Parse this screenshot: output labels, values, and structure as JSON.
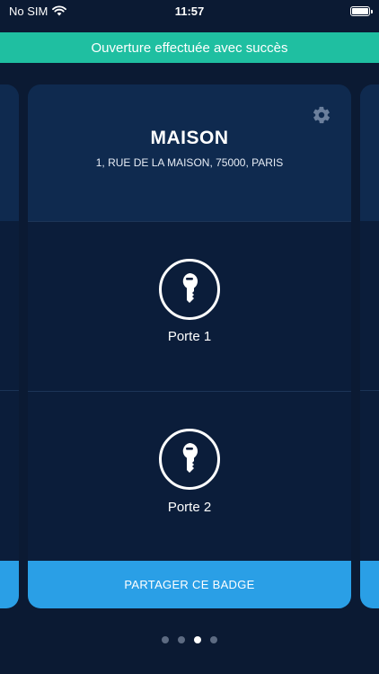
{
  "status_bar": {
    "carrier": "No SIM",
    "time": "11:57",
    "wifi_icon": "wifi-icon",
    "battery_icon": "battery-icon"
  },
  "banner": {
    "message": "Ouverture effectuée avec succès",
    "color": "#1fbfa1"
  },
  "card": {
    "title": "MAISON",
    "address": "1, RUE DE LA MAISON, 75000, PARIS",
    "settings_icon": "gear-icon",
    "doors": [
      {
        "label": "Porte 1",
        "icon": "key-icon"
      },
      {
        "label": "Porte 2",
        "icon": "key-icon"
      }
    ],
    "share_button": "PARTAGER CE BADGE"
  },
  "pagination": {
    "total": 4,
    "active_index": 2
  },
  "colors": {
    "background": "#0b1a33",
    "card_header": "#0f2a4f",
    "accent_blue": "#2a9fe6",
    "success_green": "#1fbfa1"
  }
}
